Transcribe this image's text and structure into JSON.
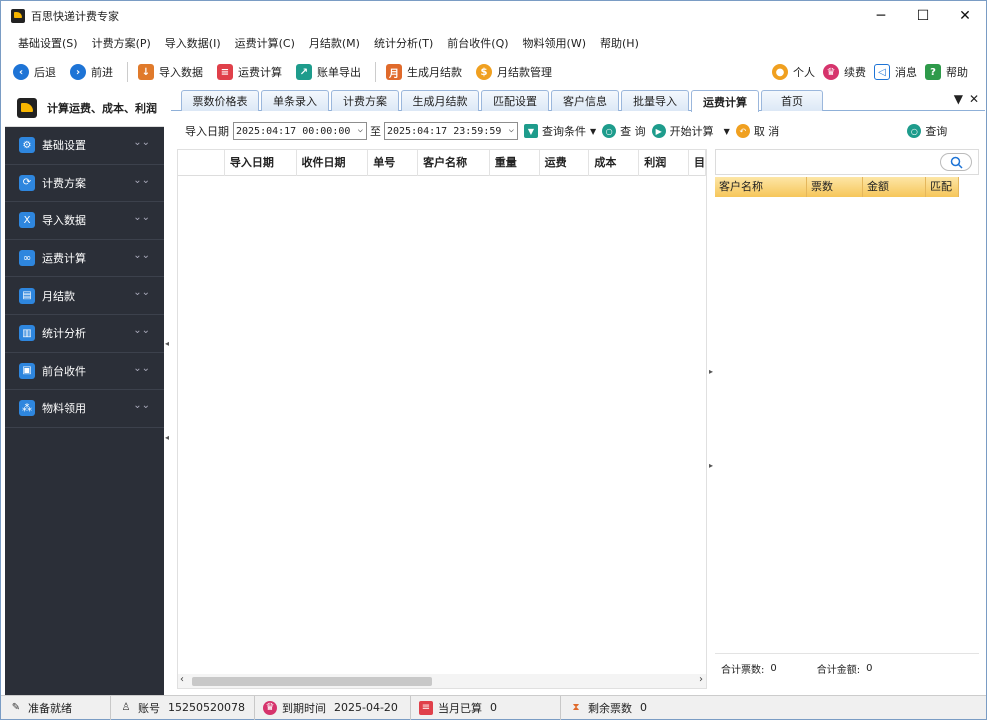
{
  "window": {
    "title": "百思快递计费专家",
    "minimize": "─",
    "maximize": "☐",
    "close": "✕"
  },
  "menu": [
    "基础设置(S)",
    "计费方案(P)",
    "导入数据(I)",
    "运费计算(C)",
    "月结款(M)",
    "统计分析(T)",
    "前台收件(Q)",
    "物料领用(W)",
    "帮助(H)"
  ],
  "toolbar": {
    "back": "后退",
    "forward": "前进",
    "import": "导入数据",
    "calc": "运费计算",
    "export": "账单导出",
    "gen_monthly": "生成月结款",
    "monthly_mgmt": "月结款管理",
    "personal": "个人",
    "renew": "续费",
    "message": "消息",
    "help": "帮助",
    "month_glyph": "月"
  },
  "sidebar": {
    "header": "计算运费、成本、利润",
    "items": [
      "基础设置",
      "计费方案",
      "导入数据",
      "运费计算",
      "月结款",
      "统计分析",
      "前台收件",
      "物料领用"
    ]
  },
  "tabs": [
    "票数价格表",
    "单条录入",
    "计费方案",
    "生成月结款",
    "匹配设置",
    "客户信息",
    "批量导入",
    "运费计算",
    "首页"
  ],
  "active_tab": "运费计算",
  "query": {
    "date_label": "导入日期",
    "from": "2025:04:17 00:00:00",
    "to_label": "至",
    "to": "2025:04:17 23:59:59",
    "conditions": "查询条件",
    "search": "查 询",
    "start_calc": "开始计算",
    "cancel": "取 消",
    "right_search": "查询"
  },
  "grid": {
    "columns": [
      "",
      "导入日期",
      "收件日期",
      "单号",
      "客户名称",
      "重量",
      "运费",
      "成本",
      "利润",
      "目的"
    ]
  },
  "right_panel": {
    "columns": [
      "客户名称",
      "票数",
      "金额",
      "匹配"
    ],
    "total_tickets_label": "合计票数:",
    "total_tickets": "0",
    "total_amount_label": "合计金额:",
    "total_amount": "0"
  },
  "status": {
    "ready": "准备就绪",
    "account_label": "账号",
    "account": "15250520078",
    "expire_label": "到期时间",
    "expire": "2025-04-20",
    "month_calc_label": "当月已算",
    "month_calc": "0",
    "remaining_label": "剩余票数",
    "remaining": "0"
  },
  "colors": {
    "accent_blue": "#1e74d6",
    "sidebar_bg": "#2b2f38",
    "header_orange": "#f6c65a",
    "logo_yellow": "#f7b500"
  }
}
